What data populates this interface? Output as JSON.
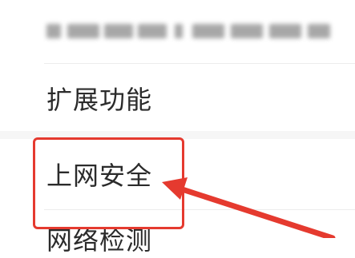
{
  "settings_list": {
    "top_item_label_blurred": "",
    "items": [
      {
        "label": "扩展功能"
      },
      {
        "label": "上网安全"
      },
      {
        "label": "网络检测"
      }
    ]
  },
  "annotation": {
    "highlight_color": "#e53a2f",
    "arrow_color": "#e53a2f"
  }
}
